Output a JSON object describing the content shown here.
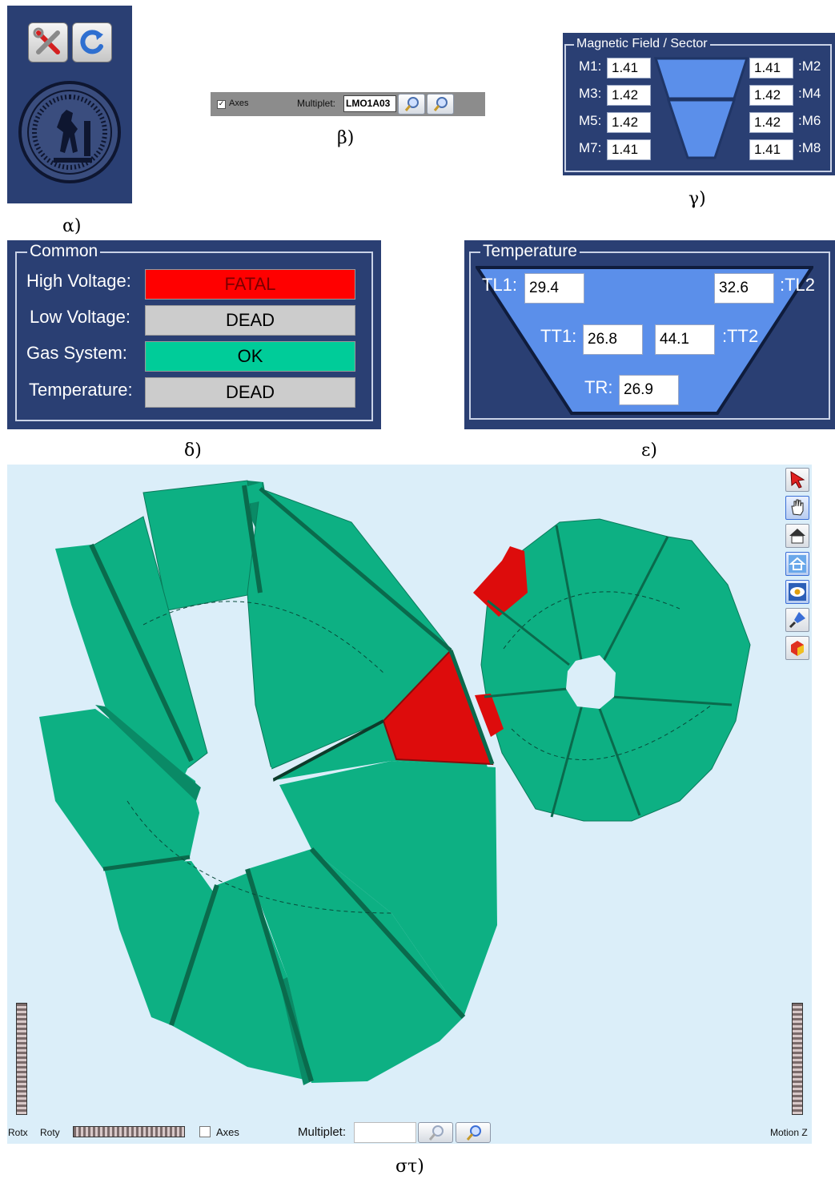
{
  "captions": {
    "a": "α)",
    "b": "β)",
    "c": "γ)",
    "d": "δ)",
    "e": "ε)",
    "f": "στ)"
  },
  "panel_a": {
    "icons": [
      "tools-icon",
      "refresh-icon",
      "university-seal-icon"
    ]
  },
  "panel_b": {
    "axes_label": "Axes",
    "axes_checked": true,
    "multiplet_label": "Multiplet:",
    "multiplet_value": "LMO1A03"
  },
  "panel_c": {
    "title": "Magnetic Field / Sector",
    "left": [
      {
        "label": "M1:",
        "value": "1.41"
      },
      {
        "label": "M3:",
        "value": "1.42"
      },
      {
        "label": "M5:",
        "value": "1.42"
      },
      {
        "label": "M7:",
        "value": "1.41"
      }
    ],
    "right": [
      {
        "label": ":M2",
        "value": "1.41"
      },
      {
        "label": ":M4",
        "value": "1.42"
      },
      {
        "label": ":M6",
        "value": "1.42"
      },
      {
        "label": ":M8",
        "value": "1.41"
      }
    ]
  },
  "panel_d": {
    "title": "Common",
    "rows": [
      {
        "label": "High Voltage:",
        "status": "FATAL",
        "color": "#ff0000",
        "text_color": "#7a0000"
      },
      {
        "label": "Low Voltage:",
        "status": "DEAD",
        "color": "#cccccc",
        "text_color": "#000000"
      },
      {
        "label": "Gas System:",
        "status": "OK",
        "color": "#00cc99",
        "text_color": "#000000"
      },
      {
        "label": "Temperature:",
        "status": "DEAD",
        "color": "#cccccc",
        "text_color": "#000000"
      }
    ]
  },
  "panel_e": {
    "title": "Temperature",
    "tl1_label": "TL1:",
    "tl1_value": "29.4",
    "tl2_label": ":TL2",
    "tl2_value": "32.6",
    "tt1_label": "TT1:",
    "tt1_value": "26.8",
    "tt2_label": ":TT2",
    "tt2_value": "44.1",
    "tr_label": "TR:",
    "tr_value": "26.9"
  },
  "panel_f": {
    "background": "#dbeef9",
    "green": "#0db083",
    "red": "#dd0c0c",
    "toolbar": [
      "select-arrow-icon",
      "pan-hand-icon",
      "home-view-icon",
      "set-home-icon",
      "view-eye-icon",
      "flashlight-icon",
      "shape-icon"
    ],
    "rotx_label": "Rotx",
    "roty_label": "Roty",
    "axes_label": "Axes",
    "axes_checked": false,
    "multiplet_label": "Multiplet:",
    "multiplet_value": "",
    "motion_label": "Motion Z"
  }
}
